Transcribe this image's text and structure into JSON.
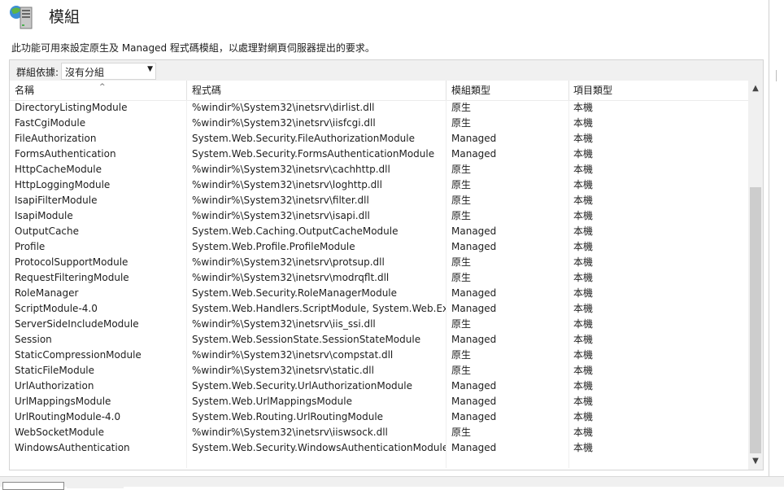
{
  "page": {
    "title": "模組",
    "description": "此功能可用來設定原生及 Managed 程式碼模組，以處理對網頁伺服器提出的要求。"
  },
  "group_by": {
    "label": "群組依據:",
    "selected": "沒有分組"
  },
  "columns": {
    "name": "名稱",
    "code": "程式碼",
    "module_type": "模組類型",
    "entry_type": "項目類型"
  },
  "rows": [
    {
      "name": "DirectoryListingModule",
      "code": "%windir%\\System32\\inetsrv\\dirlist.dll",
      "module_type": "原生",
      "entry_type": "本機"
    },
    {
      "name": "FastCgiModule",
      "code": "%windir%\\System32\\inetsrv\\iisfcgi.dll",
      "module_type": "原生",
      "entry_type": "本機"
    },
    {
      "name": "FileAuthorization",
      "code": "System.Web.Security.FileAuthorizationModule",
      "module_type": "Managed",
      "entry_type": "本機"
    },
    {
      "name": "FormsAuthentication",
      "code": "System.Web.Security.FormsAuthenticationModule",
      "module_type": "Managed",
      "entry_type": "本機"
    },
    {
      "name": "HttpCacheModule",
      "code": "%windir%\\System32\\inetsrv\\cachhttp.dll",
      "module_type": "原生",
      "entry_type": "本機"
    },
    {
      "name": "HttpLoggingModule",
      "code": "%windir%\\System32\\inetsrv\\loghttp.dll",
      "module_type": "原生",
      "entry_type": "本機"
    },
    {
      "name": "IsapiFilterModule",
      "code": "%windir%\\System32\\inetsrv\\filter.dll",
      "module_type": "原生",
      "entry_type": "本機"
    },
    {
      "name": "IsapiModule",
      "code": "%windir%\\System32\\inetsrv\\isapi.dll",
      "module_type": "原生",
      "entry_type": "本機"
    },
    {
      "name": "OutputCache",
      "code": "System.Web.Caching.OutputCacheModule",
      "module_type": "Managed",
      "entry_type": "本機"
    },
    {
      "name": "Profile",
      "code": "System.Web.Profile.ProfileModule",
      "module_type": "Managed",
      "entry_type": "本機"
    },
    {
      "name": "ProtocolSupportModule",
      "code": "%windir%\\System32\\inetsrv\\protsup.dll",
      "module_type": "原生",
      "entry_type": "本機"
    },
    {
      "name": "RequestFilteringModule",
      "code": "%windir%\\System32\\inetsrv\\modrqflt.dll",
      "module_type": "原生",
      "entry_type": "本機"
    },
    {
      "name": "RoleManager",
      "code": "System.Web.Security.RoleManagerModule",
      "module_type": "Managed",
      "entry_type": "本機"
    },
    {
      "name": "ScriptModule-4.0",
      "code": "System.Web.Handlers.ScriptModule, System.Web.Ex...",
      "module_type": "Managed",
      "entry_type": "本機"
    },
    {
      "name": "ServerSideIncludeModule",
      "code": "%windir%\\System32\\inetsrv\\iis_ssi.dll",
      "module_type": "原生",
      "entry_type": "本機"
    },
    {
      "name": "Session",
      "code": "System.Web.SessionState.SessionStateModule",
      "module_type": "Managed",
      "entry_type": "本機"
    },
    {
      "name": "StaticCompressionModule",
      "code": "%windir%\\System32\\inetsrv\\compstat.dll",
      "module_type": "原生",
      "entry_type": "本機"
    },
    {
      "name": "StaticFileModule",
      "code": "%windir%\\System32\\inetsrv\\static.dll",
      "module_type": "原生",
      "entry_type": "本機"
    },
    {
      "name": "UrlAuthorization",
      "code": "System.Web.Security.UrlAuthorizationModule",
      "module_type": "Managed",
      "entry_type": "本機"
    },
    {
      "name": "UrlMappingsModule",
      "code": "System.Web.UrlMappingsModule",
      "module_type": "Managed",
      "entry_type": "本機"
    },
    {
      "name": "UrlRoutingModule-4.0",
      "code": "System.Web.Routing.UrlRoutingModule",
      "module_type": "Managed",
      "entry_type": "本機"
    },
    {
      "name": "WebSocketModule",
      "code": "%windir%\\System32\\inetsrv\\iiswsock.dll",
      "module_type": "原生",
      "entry_type": "本機"
    },
    {
      "name": "WindowsAuthentication",
      "code": "System.Web.Security.WindowsAuthenticationModule",
      "module_type": "Managed",
      "entry_type": "本機"
    }
  ],
  "icons": {
    "title": "modules-server-icon",
    "sort": "sort-ascending-icon",
    "dropdown": "chevron-down-icon",
    "scroll_up": "scroll-up-arrow-icon",
    "scroll_down": "scroll-down-arrow-icon"
  },
  "colors": {
    "annotation_ink": "#1a1a1a",
    "panel_border": "#d4d4d4",
    "scroll_thumb": "#cdcdcd"
  }
}
